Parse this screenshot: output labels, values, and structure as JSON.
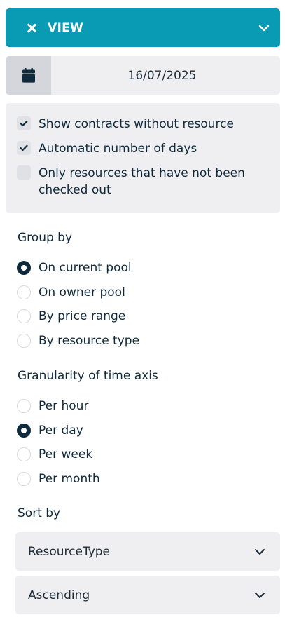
{
  "header": {
    "title": "VIEW",
    "background": "#0a9bb4"
  },
  "date": {
    "value": "16/07/2025"
  },
  "options": [
    {
      "label": "Show contracts without resource",
      "checked": true
    },
    {
      "label": "Automatic number of days",
      "checked": true
    },
    {
      "label": "Only resources that have not been checked out",
      "checked": false
    }
  ],
  "group_by": {
    "title": "Group by",
    "items": [
      {
        "label": "On current pool",
        "selected": true
      },
      {
        "label": "On owner pool",
        "selected": false
      },
      {
        "label": "By price range",
        "selected": false
      },
      {
        "label": "By resource type",
        "selected": false
      }
    ]
  },
  "granularity": {
    "title": "Granularity of time axis",
    "items": [
      {
        "label": "Per hour",
        "selected": false
      },
      {
        "label": "Per day",
        "selected": true
      },
      {
        "label": "Per week",
        "selected": false
      },
      {
        "label": "Per month",
        "selected": false
      }
    ]
  },
  "sort_by": {
    "title": "Sort by",
    "field": "ResourceType",
    "direction": "Ascending"
  },
  "icons": {
    "close": "close-icon",
    "collapse": "chevron-down-icon",
    "calendar": "calendar-icon",
    "check": "checkmark-icon"
  },
  "colors": {
    "accent": "#0a9bb4",
    "text": "#0f2a3d",
    "panel": "#efeef0"
  }
}
